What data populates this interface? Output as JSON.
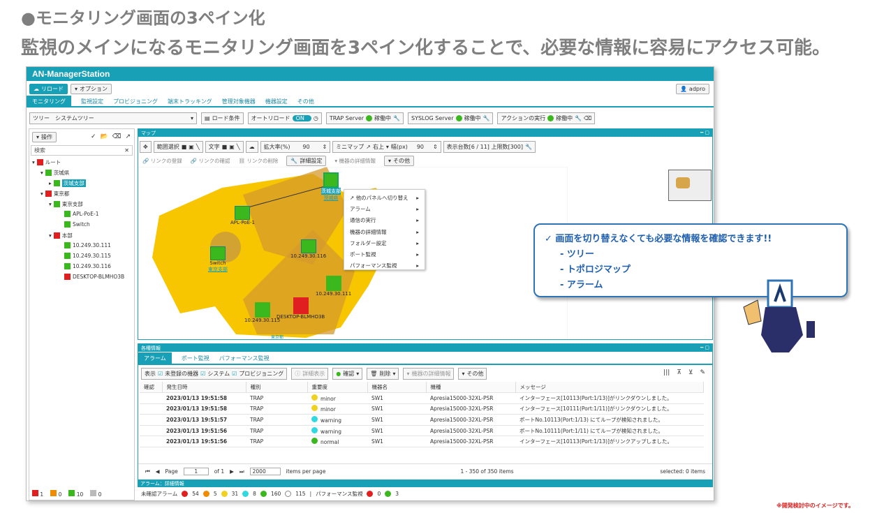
{
  "slide": {
    "heading": "●モニタリング画面の3ペイン化",
    "subheading": "監視のメインになるモニタリング画面を3ペイン化することで、必要な情報に容易にアクセス可能。",
    "footnote": "※開発検討中のイメージです。"
  },
  "app": {
    "title": "AN-ManagerStation",
    "user": "adpro",
    "reload_label": "リロード",
    "options_label": "オプション"
  },
  "nav": {
    "tabs": [
      "モニタリング",
      "監視設定",
      "プロビジョニング",
      "端末トラッキング",
      "管理対象機器",
      "機器設定",
      "その他"
    ]
  },
  "toolbar": {
    "tree_label": "ツリー",
    "tree_value": "システムツリー",
    "load_cond": "ロード条件",
    "auto_reload": "オートリロード",
    "auto_on": "ON",
    "trap_label": "TRAP Server",
    "trap_status": "稼働中",
    "syslog_label": "SYSLOG Server",
    "syslog_status": "稼働中",
    "action_label": "アクションの実行",
    "action_status": "稼働中"
  },
  "tree": {
    "ops": "操作",
    "search_placeholder": "検索",
    "items": [
      "ルート",
      "茨城県",
      "茨城支部",
      "東京都",
      "東京支部",
      "APL-PoE-1",
      "Switch",
      "本部",
      "10.249.30.111",
      "10.249.30.115",
      "10.249.30.116",
      "DESKTOP-BLMHO3B"
    ],
    "counts": [
      "1",
      "0",
      "10",
      "0"
    ]
  },
  "map": {
    "title": "マップ",
    "range_select": "範囲選択",
    "text": "文字",
    "zoom_label": "拡大率(%)",
    "zoom_value": "90",
    "minimap_label": "ミニマップ",
    "minimap_pos": "右上",
    "width_label": "幅(px)",
    "width_value": "90",
    "display_count": "表示台数[6 / 11] 上限数[300]",
    "link_register": "リンクの登録",
    "link_confirm": "リンクの確認",
    "link_delete": "リンクの削除",
    "detail_settings": "詳細設定",
    "device_detail": "機器の詳細情報",
    "other": "その他",
    "nodes": [
      "茨城支部",
      "茨城県",
      "APL-PoE-1",
      "Switch",
      "東京支部",
      "10.249.30.116",
      "10.249.30.111",
      "10.249.30.115",
      "DESKTOP-BLMHO3B",
      "東京都"
    ],
    "context_menu": [
      "他のパネルへ切り替え",
      "アラーム",
      "通信の実行",
      "機器の詳細情報",
      "フォルダー設定",
      "ポート監視",
      "パフォーマンス監視"
    ]
  },
  "info": {
    "title": "各種情報",
    "tabs": [
      "アラーム",
      "ポート監視",
      "パフォーマンス監視"
    ],
    "display": "表示",
    "chk_unregistered": "未登録の機器",
    "chk_system": "システム",
    "chk_provisioning": "プロビジョニング",
    "detail_btn": "詳細表示",
    "confirm_btn": "確認",
    "delete_btn": "削除",
    "device_detail": "機器の詳細情報",
    "other": "その他",
    "columns": [
      "確認",
      "発生日時",
      "種別",
      "重要度",
      "機器名",
      "機種",
      "メッセージ"
    ],
    "rows": [
      [
        "",
        "2023/01/13 19:51:58",
        "TRAP",
        "minor",
        "SW1",
        "Apresia15000-32XL-PSR",
        "インターフェース[10113(Port:1/13)]がリンクダウンしました。"
      ],
      [
        "",
        "2023/01/13 19:51:58",
        "TRAP",
        "minor",
        "SW1",
        "Apresia15000-32XL-PSR",
        "インターフェース[10111(Port:1/11)]がリンクダウンしました。"
      ],
      [
        "",
        "2023/01/13 19:51:57",
        "TRAP",
        "warning",
        "SW1",
        "Apresia15000-32XL-PSR",
        "ポートNo.10113(Port:1/13) にてループが検知されました。"
      ],
      [
        "",
        "2023/01/13 19:51:56",
        "TRAP",
        "warning",
        "SW1",
        "Apresia15000-32XL-PSR",
        "ポートNo.10111(Port:1/11) にてループが検知されました。"
      ],
      [
        "",
        "2023/01/13 19:51:56",
        "TRAP",
        "normal",
        "SW1",
        "Apresia15000-32XL-PSR",
        "インターフェース[10113(Port:1/13)]がリンクアップしました。"
      ]
    ],
    "page_label": "Page",
    "page": "1",
    "of": "of 1",
    "per_page": "2000",
    "per_page_label": "items per page",
    "range": "1 - 350 of 350 items",
    "selected": "selected: 0 items"
  },
  "alarm_detail": {
    "title": "アラーム：詳細情報",
    "unconfirmed": "未確認アラーム",
    "counts": [
      "54",
      "5",
      "31",
      "8",
      "160",
      "115"
    ],
    "perf": "パフォーマンス監視",
    "perf_counts": [
      "0",
      "3"
    ]
  },
  "callout": {
    "title": "✓ 画面を切り替えなくても必要な情報を確認できます!!",
    "items": [
      "- ツリー",
      "- トポロジマップ",
      "- アラーム"
    ]
  },
  "colors": {
    "accent": "#18a0b6",
    "map_yellow": "#f7c600",
    "node_green": "#3cb81f",
    "red": "#e02020"
  }
}
